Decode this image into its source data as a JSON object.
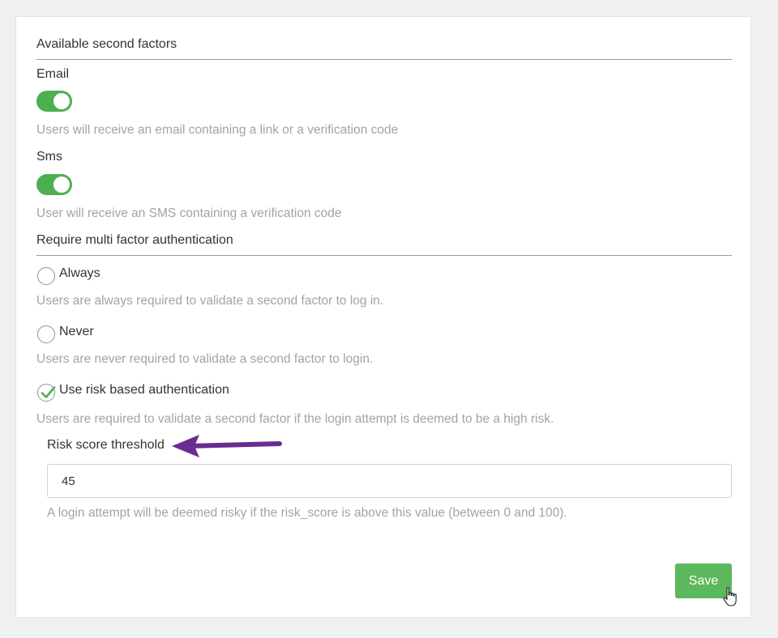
{
  "second_factors": {
    "title": "Available second factors",
    "email": {
      "label": "Email",
      "enabled": true,
      "help": "Users will receive an email containing a link or a verification code"
    },
    "sms": {
      "label": "Sms",
      "enabled": true,
      "help": "User will receive an SMS containing a verification code"
    }
  },
  "mfa": {
    "title": "Require multi factor authentication",
    "options": [
      {
        "label": "Always",
        "checked": false,
        "help": "Users are always required to validate a second factor to log in."
      },
      {
        "label": "Never",
        "checked": false,
        "help": "Users are never required to validate a second factor to login."
      },
      {
        "label": "Use risk based authentication",
        "checked": true,
        "help": "Users are required to validate a second factor if the login attempt is deemed to be a high risk."
      }
    ]
  },
  "risk": {
    "label": "Risk score threshold",
    "value": "45",
    "help": "A login attempt will be deemed risky if the risk_score is above this value (between 0 and 100)."
  },
  "actions": {
    "save_label": "Save"
  },
  "colors": {
    "toggle_on": "#4caf50",
    "save_button": "#5cb85c",
    "annotation_arrow": "#6a2c91",
    "check_mark": "#4caf50"
  },
  "icons": {
    "annotation": "arrow-left-icon",
    "cursor": "hand-pointer-icon",
    "check": "checkmark-icon"
  }
}
